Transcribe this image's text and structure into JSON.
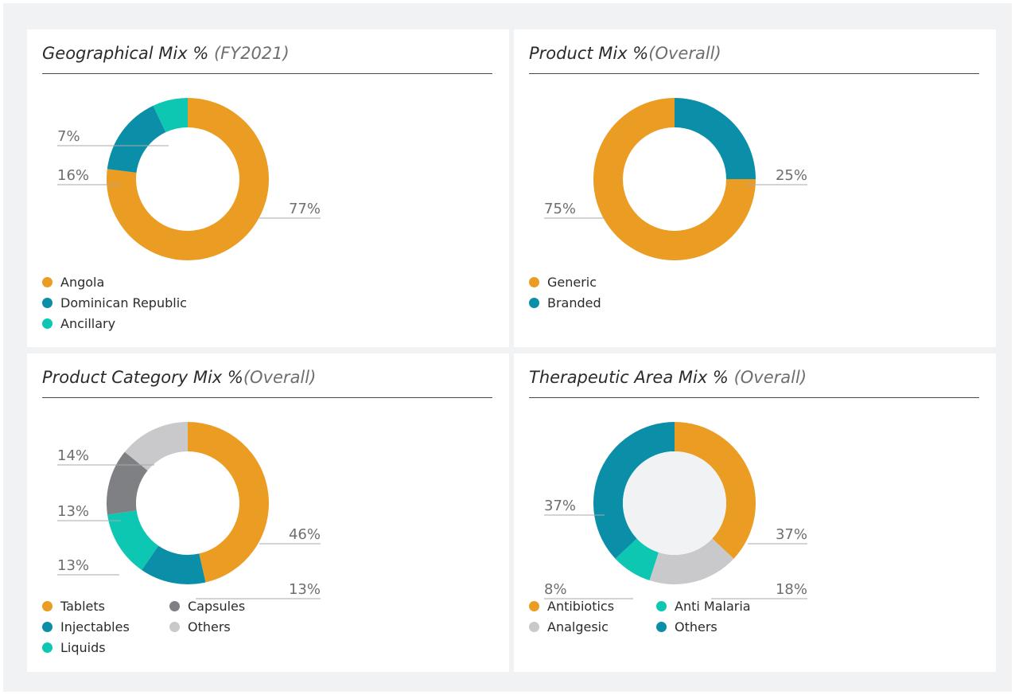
{
  "colors": {
    "orange": "#eb9c22",
    "teal": "#0b8fa8",
    "aqua": "#0ec7b2",
    "dark_gray": "#7f8084",
    "light_gray": "#c9c9cb",
    "hole_gray": "#f0f2f4",
    "label_gray": "#6e6e6e",
    "leader_gray": "#a8a8a8",
    "title_gray": "#2b2b2b"
  },
  "panels": [
    {
      "title": "Geographical Mix %",
      "subtitle": "(FY2021)"
    },
    {
      "title": "Product Mix %",
      "subtitle": "(Overall)"
    },
    {
      "title": "Product Category Mix %",
      "subtitle": "(Overall)"
    },
    {
      "title": "Therapeutic Area Mix %",
      "subtitle": "(Overall)"
    }
  ],
  "chart_data": [
    {
      "type": "pie",
      "title": "Geographical Mix % (FY2021)",
      "categories": [
        "Angola",
        "Dominican Republic",
        "Ancillary"
      ],
      "values": [
        77,
        16,
        7
      ],
      "labels": [
        "77%",
        "16%",
        "7%"
      ],
      "colors": [
        "#eb9c22",
        "#0b8fa8",
        "#0ec7b2"
      ],
      "donut": true,
      "legend": "bottom-left"
    },
    {
      "type": "pie",
      "title": "Product Mix % (Overall)",
      "categories": [
        "Branded",
        "Generic"
      ],
      "values": [
        25,
        75
      ],
      "labels": [
        "25%",
        "75%"
      ],
      "colors": [
        "#0b8fa8",
        "#eb9c22"
      ],
      "legend_order": [
        "Generic",
        "Branded"
      ],
      "legend_colors": [
        "#eb9c22",
        "#0b8fa8"
      ],
      "donut": true,
      "legend": "bottom-left"
    },
    {
      "type": "pie",
      "title": "Product Category Mix % (Overall)",
      "categories": [
        "Tablets",
        "Injectables",
        "Liquids",
        "Capsules",
        "Others"
      ],
      "values": [
        46,
        13,
        13,
        13,
        14
      ],
      "labels": [
        "46%",
        "13%",
        "13%",
        "13%",
        "14%"
      ],
      "colors": [
        "#eb9c22",
        "#0b8fa8",
        "#0ec7b2",
        "#7f8084",
        "#c9c9cb"
      ],
      "donut": true,
      "legend": "bottom-left"
    },
    {
      "type": "pie",
      "title": "Therapeutic Area Mix % (Overall)",
      "categories": [
        "Antibiotics",
        "Analgesic",
        "Anti Malaria",
        "Others"
      ],
      "values": [
        37,
        18,
        8,
        37
      ],
      "labels": [
        "37%",
        "18%",
        "8%",
        "37%"
      ],
      "colors": [
        "#eb9c22",
        "#c9c9cb",
        "#0ec7b2",
        "#0b8fa8"
      ],
      "donut": true,
      "hole_color": "#f0f2f4",
      "legend": "bottom-left"
    }
  ]
}
